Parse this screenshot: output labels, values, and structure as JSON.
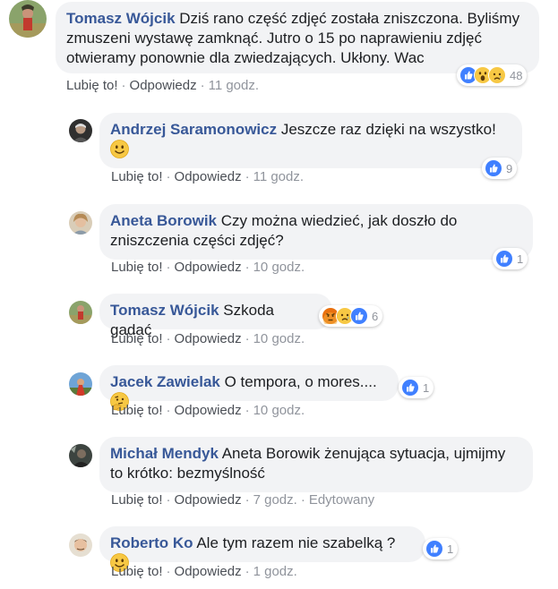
{
  "action_labels": {
    "like": "Lubię to!",
    "reply": "Odpowiedz",
    "separator": "·"
  },
  "comments": [
    {
      "author": "Tomasz Wójcik",
      "text": "Dziś rano część zdjęć została zniszczona. Byliśmy zmuszeni wystawę zamknąć. Jutro o 15 po naprawieniu zdjęć otwieramy ponownie dla zwiedzających. Ukłony. Wac",
      "reactions": [
        "like-reaction-icon",
        "wow-reaction-icon",
        "sad-reaction-icon"
      ],
      "reaction_count": "48",
      "time": "11 godz."
    },
    {
      "author": "Andrzej Saramonowicz",
      "text": "Jeszcze raz dzięki na wszystko!",
      "emoji": "smile-emoji",
      "reactions": [
        "like-reaction-icon"
      ],
      "reaction_count": "9",
      "time": "11 godz."
    },
    {
      "author": "Aneta Borowik",
      "text": "Czy można wiedzieć, jak doszło do zniszczenia części zdjęć?",
      "reactions": [
        "like-reaction-icon"
      ],
      "reaction_count": "1",
      "time": "10 godz."
    },
    {
      "author": "Tomasz Wójcik",
      "text": "Szkoda gadać",
      "reactions": [
        "angry-reaction-icon",
        "sad-reaction-icon",
        "like-reaction-icon"
      ],
      "reaction_count": "6",
      "time": "10 godz."
    },
    {
      "author": "Jacek Zawielak",
      "text": "O tempora, o mores....",
      "emoji": "thinking-emoji",
      "reactions": [
        "like-reaction-icon"
      ],
      "reaction_count": "1",
      "time": "10 godz."
    },
    {
      "author": "Michał Mendyk",
      "text": "Aneta Borowik żenująca sytuacja, ujmijmy to krótko: bezmyślność",
      "time": "7 godz.",
      "edited": "Edytowany"
    },
    {
      "author": "Roberto Ko",
      "text": "Ale tym razem nie szabelką ?",
      "emoji": "smile-emoji",
      "reactions": [
        "like-reaction-icon"
      ],
      "reaction_count": "1",
      "time": "1 godz."
    }
  ],
  "colors": {
    "author": "#385898",
    "bubble": "#f2f3f5",
    "like": "#4080ff",
    "emoji_yellow": "#f7c844",
    "angry": "#e9710f"
  }
}
